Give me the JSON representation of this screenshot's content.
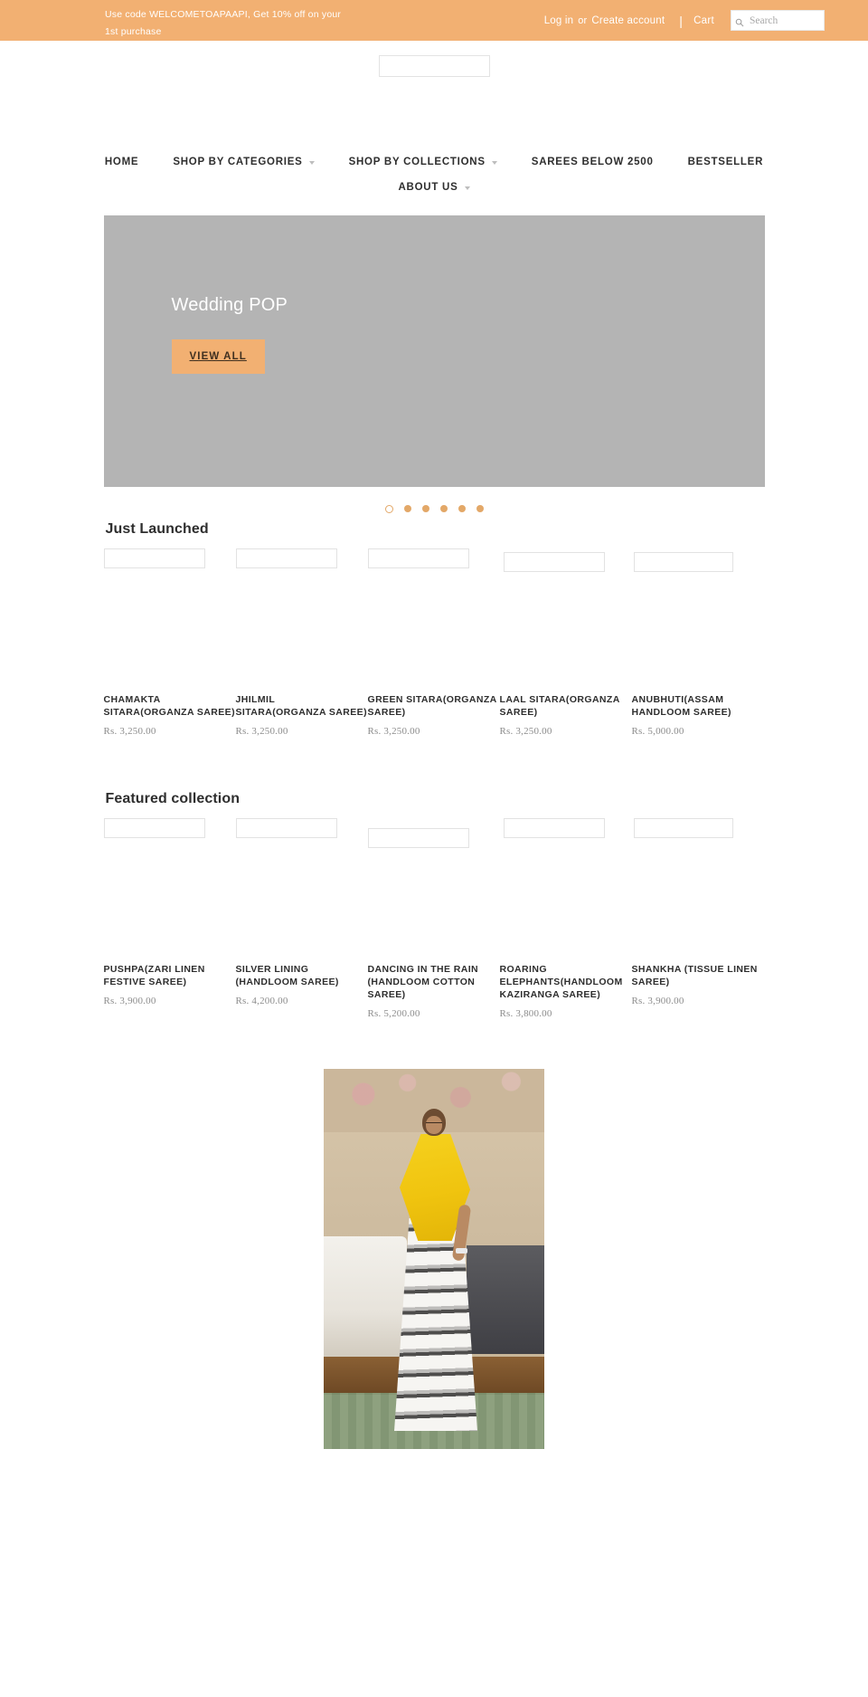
{
  "topbar": {
    "promo_text": "Use code WELCOMETOAPAAPI, Get 10% off on your 1st purchase",
    "login_label": "Log in",
    "or_label": "or",
    "create_account_label": "Create account",
    "divider": "|",
    "cart_label": "Cart",
    "search_placeholder": "Search",
    "search_value": "",
    "search_icon": "search-icon",
    "background_color": "#f2b072"
  },
  "header": {
    "logo_alt": "site-logo"
  },
  "nav": {
    "row1": [
      {
        "label": "HOME",
        "has_caret": false
      },
      {
        "label": "SHOP BY CATEGORIES",
        "has_caret": true
      },
      {
        "label": "SHOP BY COLLECTIONS",
        "has_caret": true
      },
      {
        "label": "SAREES BELOW 2500",
        "has_caret": false
      },
      {
        "label": "BESTSELLER",
        "has_caret": false
      }
    ],
    "row2": [
      {
        "label": "ABOUT US",
        "has_caret": true
      }
    ]
  },
  "hero": {
    "title": "Wedding POP",
    "button_label": "VIEW ALL",
    "button_color": "#f2b072",
    "slide_count": 6,
    "active_slide": 1,
    "dot_color": "#e3a868"
  },
  "sections": [
    {
      "title": "Just Launched",
      "products": [
        {
          "title": "CHAMAKTA SITARA(ORGANZA SAREE)",
          "price": "Rs. 3,250.00"
        },
        {
          "title": "JHILMIL SITARA(ORGANZA SAREE)",
          "price": "Rs. 3,250.00"
        },
        {
          "title": "GREEN SITARA(ORGANZA SAREE)",
          "price": "Rs. 3,250.00"
        },
        {
          "title": "LAAL SITARA(ORGANZA SAREE)",
          "price": "Rs. 3,250.00"
        },
        {
          "title": "ANUBHUTI(ASSAM HANDLOOM SAREE)",
          "price": "Rs. 5,000.00"
        }
      ]
    },
    {
      "title": "Featured collection",
      "products": [
        {
          "title": "PUSHPA(ZARI LINEN FESTIVE SAREE)",
          "price": "Rs. 3,900.00"
        },
        {
          "title": "SILVER LINING (HANDLOOM SAREE)",
          "price": "Rs. 4,200.00"
        },
        {
          "title": "DANCING IN THE RAIN (HANDLOOM COTTON SAREE)",
          "price": "Rs. 5,200.00"
        },
        {
          "title": "ROARING ELEPHANTS(HANDLOOM KAZIRANGA SAREE)",
          "price": "Rs. 3,800.00"
        },
        {
          "title": "SHANKHA (TISSUE LINEN SAREE)",
          "price": "Rs. 3,900.00"
        }
      ]
    }
  ],
  "lifestyle": {
    "alt": "woman-wearing-saree-photo"
  }
}
